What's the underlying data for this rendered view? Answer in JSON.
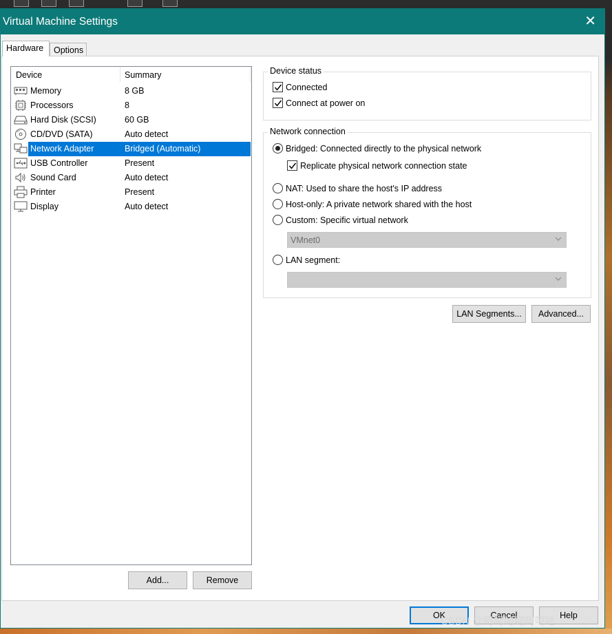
{
  "window": {
    "title": "Virtual Machine Settings",
    "close_glyph": "✕"
  },
  "tabs": [
    {
      "label": "Hardware",
      "active": true
    },
    {
      "label": "Options",
      "active": false
    }
  ],
  "device_list": {
    "headers": {
      "device": "Device",
      "summary": "Summary"
    },
    "rows": [
      {
        "name": "Memory",
        "summary": "8 GB",
        "icon": "memory-icon"
      },
      {
        "name": "Processors",
        "summary": "8",
        "icon": "processor-icon"
      },
      {
        "name": "Hard Disk (SCSI)",
        "summary": "60 GB",
        "icon": "hard-disk-icon"
      },
      {
        "name": "CD/DVD (SATA)",
        "summary": "Auto detect",
        "icon": "cd-dvd-icon"
      },
      {
        "name": "Network Adapter",
        "summary": "Bridged (Automatic)",
        "icon": "network-adapter-icon",
        "selected": true
      },
      {
        "name": "USB Controller",
        "summary": "Present",
        "icon": "usb-icon"
      },
      {
        "name": "Sound Card",
        "summary": "Auto detect",
        "icon": "speaker-icon"
      },
      {
        "name": "Printer",
        "summary": "Present",
        "icon": "printer-icon"
      },
      {
        "name": "Display",
        "summary": "Auto detect",
        "icon": "display-icon"
      }
    ],
    "add_label": "Add...",
    "remove_label": "Remove"
  },
  "device_status": {
    "title": "Device status",
    "connected_label": "Connected",
    "connected_checked": true,
    "power_on_label": "Connect at power on",
    "power_on_checked": true
  },
  "network_connection": {
    "title": "Network connection",
    "bridged_label": "Bridged: Connected directly to the physical network",
    "replicate_label": "Replicate physical network connection state",
    "replicate_checked": true,
    "nat_label": "NAT: Used to share the host's IP address",
    "hostonly_label": "Host-only: A private network shared with the host",
    "custom_label": "Custom: Specific virtual network",
    "custom_value": "VMnet0",
    "lan_label": "LAN segment:",
    "lan_value": "",
    "selected": "bridged"
  },
  "buttons": {
    "lan_segments": "LAN Segments...",
    "advanced": "Advanced...",
    "ok": "OK",
    "cancel": "Cancel",
    "help": "Help"
  },
  "watermark": "CSDN @呵呵呵呵呵呵哈",
  "colors": {
    "titlebar": "#0c7a78",
    "selection": "#0078d7"
  }
}
